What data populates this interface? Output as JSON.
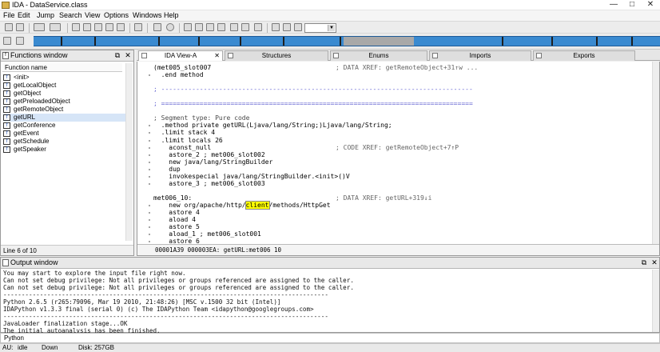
{
  "window": {
    "title": "IDA - DataService.class",
    "controls": [
      "—",
      "□",
      "✕"
    ]
  },
  "menu": [
    "File",
    "Edit",
    "Jump",
    "Search",
    "View",
    "Options",
    "Windows",
    "Help"
  ],
  "functions_window": {
    "title": "Functions window",
    "column_header": "Function name",
    "items": [
      "<init>",
      "getLocalObject",
      "getObject",
      "getPreloadedObject",
      "getRemoteObject",
      "getURL",
      "getConference",
      "getEvent",
      "getSchedule",
      "getSpeaker"
    ],
    "selected": "getURL",
    "status": "Line 6 of 10"
  },
  "tabs": [
    {
      "label": "IDA View-A",
      "active": true
    },
    {
      "label": "Structures",
      "active": false
    },
    {
      "label": "Enums",
      "active": false
    },
    {
      "label": "Imports",
      "active": false
    },
    {
      "label": "Exports",
      "active": false
    }
  ],
  "ida_view": {
    "lines": [
      {
        "code": "(met005_slot007",
        "comment": "; DATA XREF: getRemoteObject+31↑w ..."
      },
      {
        "code": "  .end method",
        "comment": ""
      },
      {
        "code": "",
        "comment": ""
      },
      {
        "code": "; ---------------------------------------------------------------------------------",
        "comment": ""
      },
      {
        "code": "",
        "comment": ""
      },
      {
        "code": "; =================================================================================",
        "comment": ""
      },
      {
        "code": "",
        "comment": ""
      },
      {
        "code": "; Segment type: Pure code",
        "comment": ""
      },
      {
        "code": "  .method private getURL(Ljava/lang/String;)Ljava/lang/String;",
        "comment": ""
      },
      {
        "code": "  .limit stack 4",
        "comment": ""
      },
      {
        "code": "  .limit locals 26",
        "comment": ""
      },
      {
        "code": "    aconst_null",
        "comment": "; CODE XREF: getRemoteObject+7↑P"
      },
      {
        "code": "    astore_2 ; met006_slot002",
        "comment": ""
      },
      {
        "code": "    new java/lang/StringBuilder",
        "comment": ""
      },
      {
        "code": "    dup",
        "comment": ""
      },
      {
        "code": "    invokespecial java/lang/StringBuilder.<init>()V",
        "comment": ""
      },
      {
        "code": "    astore_3 ; met006_slot003",
        "comment": ""
      },
      {
        "code": "",
        "comment": ""
      },
      {
        "code": "met006_10:",
        "comment": "; DATA XREF: getURL+319↓i"
      },
      {
        "code": "    new org/apache/http/client/methods/HttpGet",
        "comment": ""
      },
      {
        "code": "    astore 4",
        "comment": ""
      },
      {
        "code": "    aload 4",
        "comment": ""
      },
      {
        "code": "    astore 5",
        "comment": ""
      },
      {
        "code": "    aload_1 ; met006_slot001",
        "comment": ""
      },
      {
        "code": "    astore 6",
        "comment": ""
      }
    ],
    "highlight_word": "client",
    "status": "00001A39 000003EA: getURL:met006 10"
  },
  "output_window": {
    "title": "Output window",
    "lines": [
      "You may start to explore the input file right now.",
      "Can not set debug privilege: Not all privileges or groups referenced are assigned to the caller.",
      "Can not set debug privilege: Not all privileges or groups referenced are assigned to the caller.",
      "-----------------------------------------------------------------------------------------",
      "Python 2.6.5 (r265:79096, Mar 19 2010, 21:48:26) [MSC v.1500 32 bit (Intel)]",
      "IDAPython v1.3.3 final (serial 0) (c) The IDAPython Team <idapython@googlegroups.com>",
      "-----------------------------------------------------------------------------------------",
      "JavaLoader finalization stage...OK",
      "The initial autoanalysis has been finished."
    ]
  },
  "python_bar": {
    "label": "Python"
  },
  "statusbar": {
    "au": "AU:",
    "state": "idle",
    "direction": "Down",
    "disk": "Disk: 257GB"
  }
}
